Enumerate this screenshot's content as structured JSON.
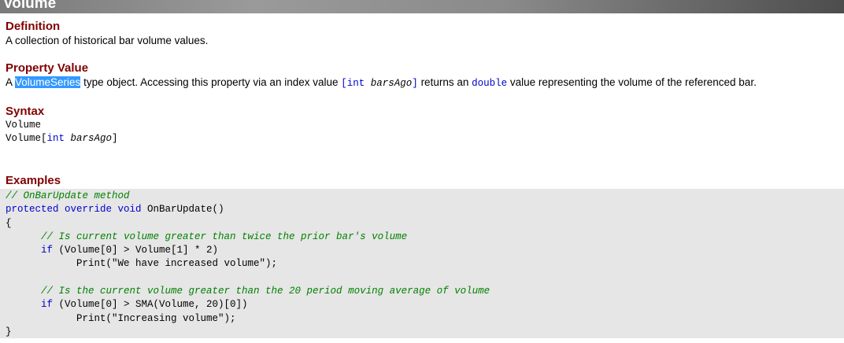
{
  "title": "Volume",
  "definition": {
    "heading": "Definition",
    "text": "A collection of historical bar volume values."
  },
  "property_value": {
    "heading": "Property Value",
    "prefix": "A ",
    "highlight": "VolumeSeries",
    "mid": " type object. Accessing this property via an index value ",
    "index_open": "[",
    "index_type": "int",
    "index_name": " barsAgo",
    "index_close": "]",
    "mid2": " returns an ",
    "return_type": "double",
    "suffix": " value representing the volume of the referenced bar."
  },
  "syntax": {
    "heading": "Syntax",
    "line1": "Volume",
    "line2_prefix": "Volume[",
    "line2_type": "int",
    "line2_name": " barsAgo",
    "line2_suffix": "]"
  },
  "examples": {
    "heading": "Examples",
    "comment1": "// OnBarUpdate method",
    "kw_protected": "protected",
    "kw_override": " override",
    "kw_void": " void",
    "method": " OnBarUpdate()",
    "open_brace": "{",
    "comment2": "// Is current volume greater than twice the prior bar's volume",
    "kw_if1": "if",
    "cond1": " (Volume[0] > Volume[1] * 2)",
    "print1": "Print(\"We have increased volume\");",
    "comment3": "// Is the current volume greater than the 20 period moving average of volume",
    "kw_if2": "if",
    "cond2": " (Volume[0] > SMA(Volume, 20)[0])",
    "print2": "Print(\"Increasing volume\");",
    "close_brace": "}"
  }
}
